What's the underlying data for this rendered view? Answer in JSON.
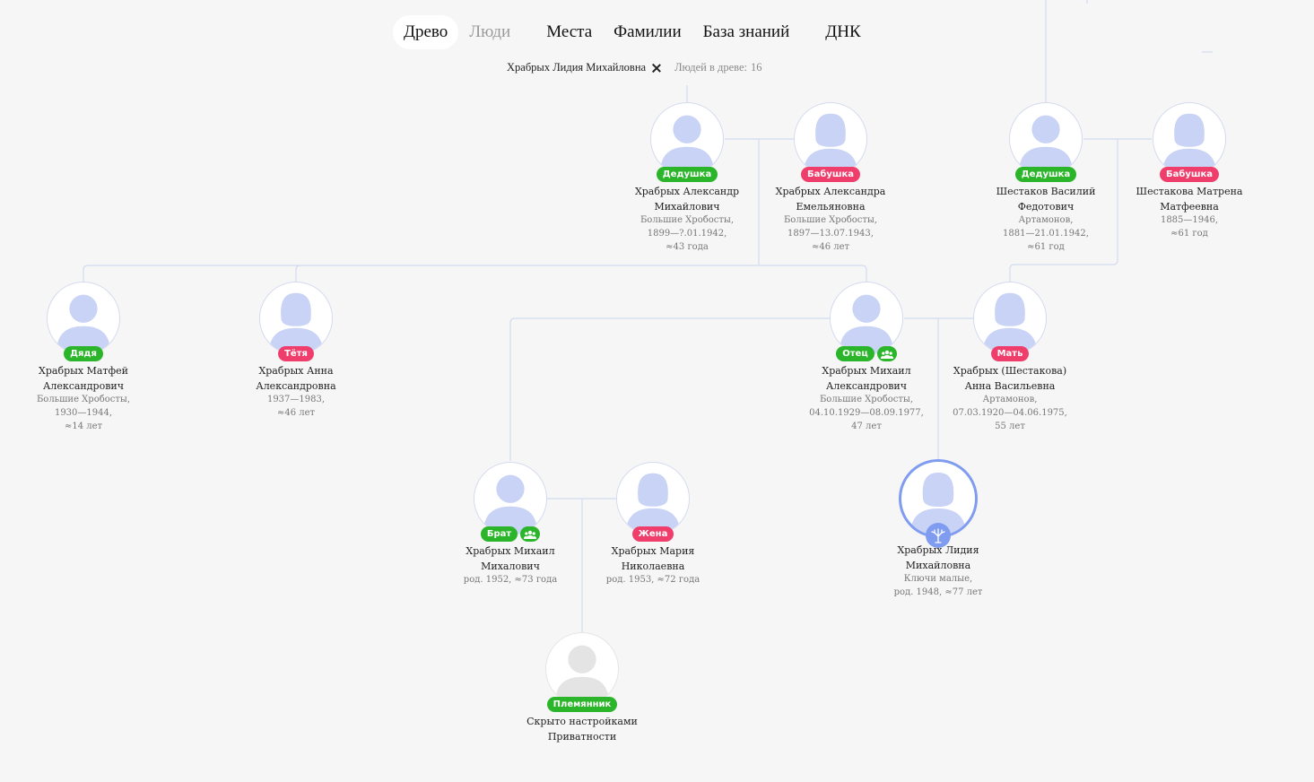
{
  "nav": {
    "tabs": [
      {
        "label": "Древо",
        "active": true
      },
      {
        "label": "Люди",
        "muted": true
      },
      {
        "label": "Места"
      },
      {
        "label": "Фамилии"
      },
      {
        "label": "База знаний"
      },
      {
        "label": "ДНК"
      }
    ]
  },
  "filter": {
    "person": "Храбрых Лидия Михайловна",
    "count_label": "Людей в древе:",
    "count": "16"
  },
  "colors": {
    "male_badge": "#2bb52a",
    "female_badge": "#ef3e6b",
    "self_ring": "#7f9cf1",
    "line": "#d4dbef"
  },
  "people": {
    "gf1": {
      "role": "Дедушка",
      "gender": "m",
      "name": [
        "Храбрых Александр",
        "Михайлович"
      ],
      "info": [
        "Большие Хробосты,",
        "1899—?.01.1942,",
        "≈43 года"
      ]
    },
    "gm1": {
      "role": "Бабушка",
      "gender": "f",
      "name": [
        "Храбрых Александра",
        "Емельяновна"
      ],
      "info": [
        "Большие Хробосты,",
        "1897—13.07.1943,",
        "≈46 лет"
      ]
    },
    "gf2": {
      "role": "Дедушка",
      "gender": "m",
      "name": [
        "Шестаков Василий",
        "Федотович"
      ],
      "info": [
        "Артамонов,",
        "1881—21.01.1942,",
        "≈61 год"
      ]
    },
    "gm2": {
      "role": "Бабушка",
      "gender": "f",
      "name": [
        "Шестакова Матрена",
        "Матфеевна"
      ],
      "info": [
        "1885—1946,",
        "≈61 год"
      ]
    },
    "uncle": {
      "role": "Дядя",
      "gender": "m",
      "name": [
        "Храбрых Матфей",
        "Александрович"
      ],
      "info": [
        "Большие Хробосты,",
        "1930—1944,",
        "≈14 лет"
      ]
    },
    "aunt": {
      "role": "Тётя",
      "gender": "f",
      "name": [
        "Храбрых Анна",
        "Александровна"
      ],
      "info": [
        "1937—1983,",
        "≈46 лет"
      ]
    },
    "father": {
      "role": "Отец",
      "gender": "m",
      "group": true,
      "name": [
        "Храбрых Михаил",
        "Александрович"
      ],
      "info": [
        "Большие Хробосты,",
        "04.10.1929—08.09.1977,",
        "47 лет"
      ]
    },
    "mother": {
      "role": "Мать",
      "gender": "f",
      "name": [
        "Храбрых (Шестакова)",
        "Анна Васильевна"
      ],
      "info": [
        "Артамонов,",
        "07.03.1920—04.06.1975,",
        "55 лет"
      ]
    },
    "brother": {
      "role": "Брат",
      "gender": "m",
      "group": true,
      "name": [
        "Храбрых Михаил",
        "Михалович"
      ],
      "info": [
        "род. 1952, ≈73 года"
      ]
    },
    "wife": {
      "role": "Жена",
      "gender": "f",
      "name": [
        "Храбрых Мария",
        "Николаевна"
      ],
      "info": [
        "род. 1953, ≈72 года"
      ]
    },
    "self": {
      "gender": "f",
      "self": true,
      "name": [
        "Храбрых Лидия",
        "Михайловна"
      ],
      "info": [
        "Ключи малые,",
        "род. 1948, ≈77 лет"
      ]
    },
    "nephew": {
      "role": "Племянник",
      "gender": "m",
      "hidden": true,
      "name": [
        "Скрыто настройками",
        "Приватности"
      ],
      "info": []
    }
  }
}
